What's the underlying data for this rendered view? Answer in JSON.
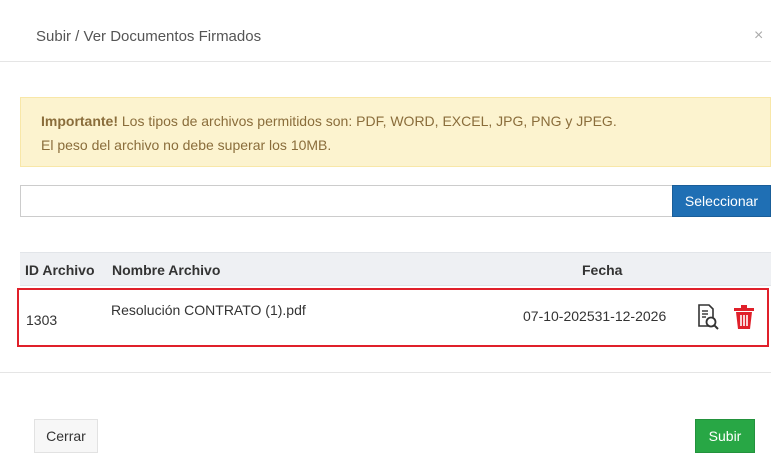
{
  "modal": {
    "title": "Subir / Ver Documentos Firmados",
    "close_symbol": "×"
  },
  "alert": {
    "strong": "Importante!",
    "line1": " Los tipos de archivos permitidos son: PDF, WORD, EXCEL, JPG, PNG y JPEG.",
    "line2": "El peso del archivo no debe superar los 10MB."
  },
  "upload": {
    "file_value": "",
    "select_label": "Seleccionar"
  },
  "table": {
    "headers": {
      "id": "ID Archivo",
      "name": "Nombre Archivo",
      "date": "Fecha"
    },
    "rows": [
      {
        "id": "1303",
        "name": "Resolución CONTRATO (1).pdf",
        "date": "07-10-202531-12-2026"
      }
    ]
  },
  "footer": {
    "close_label": "Cerrar",
    "submit_label": "Subir"
  },
  "colors": {
    "primary": "#1f6fb4",
    "success": "#28a745",
    "danger": "#e0202a",
    "warning_bg": "#fcf3cf",
    "warning_text": "#8a6d3b"
  },
  "icons": {
    "view": "document-search-icon",
    "delete": "trash-icon",
    "close": "close-icon"
  }
}
